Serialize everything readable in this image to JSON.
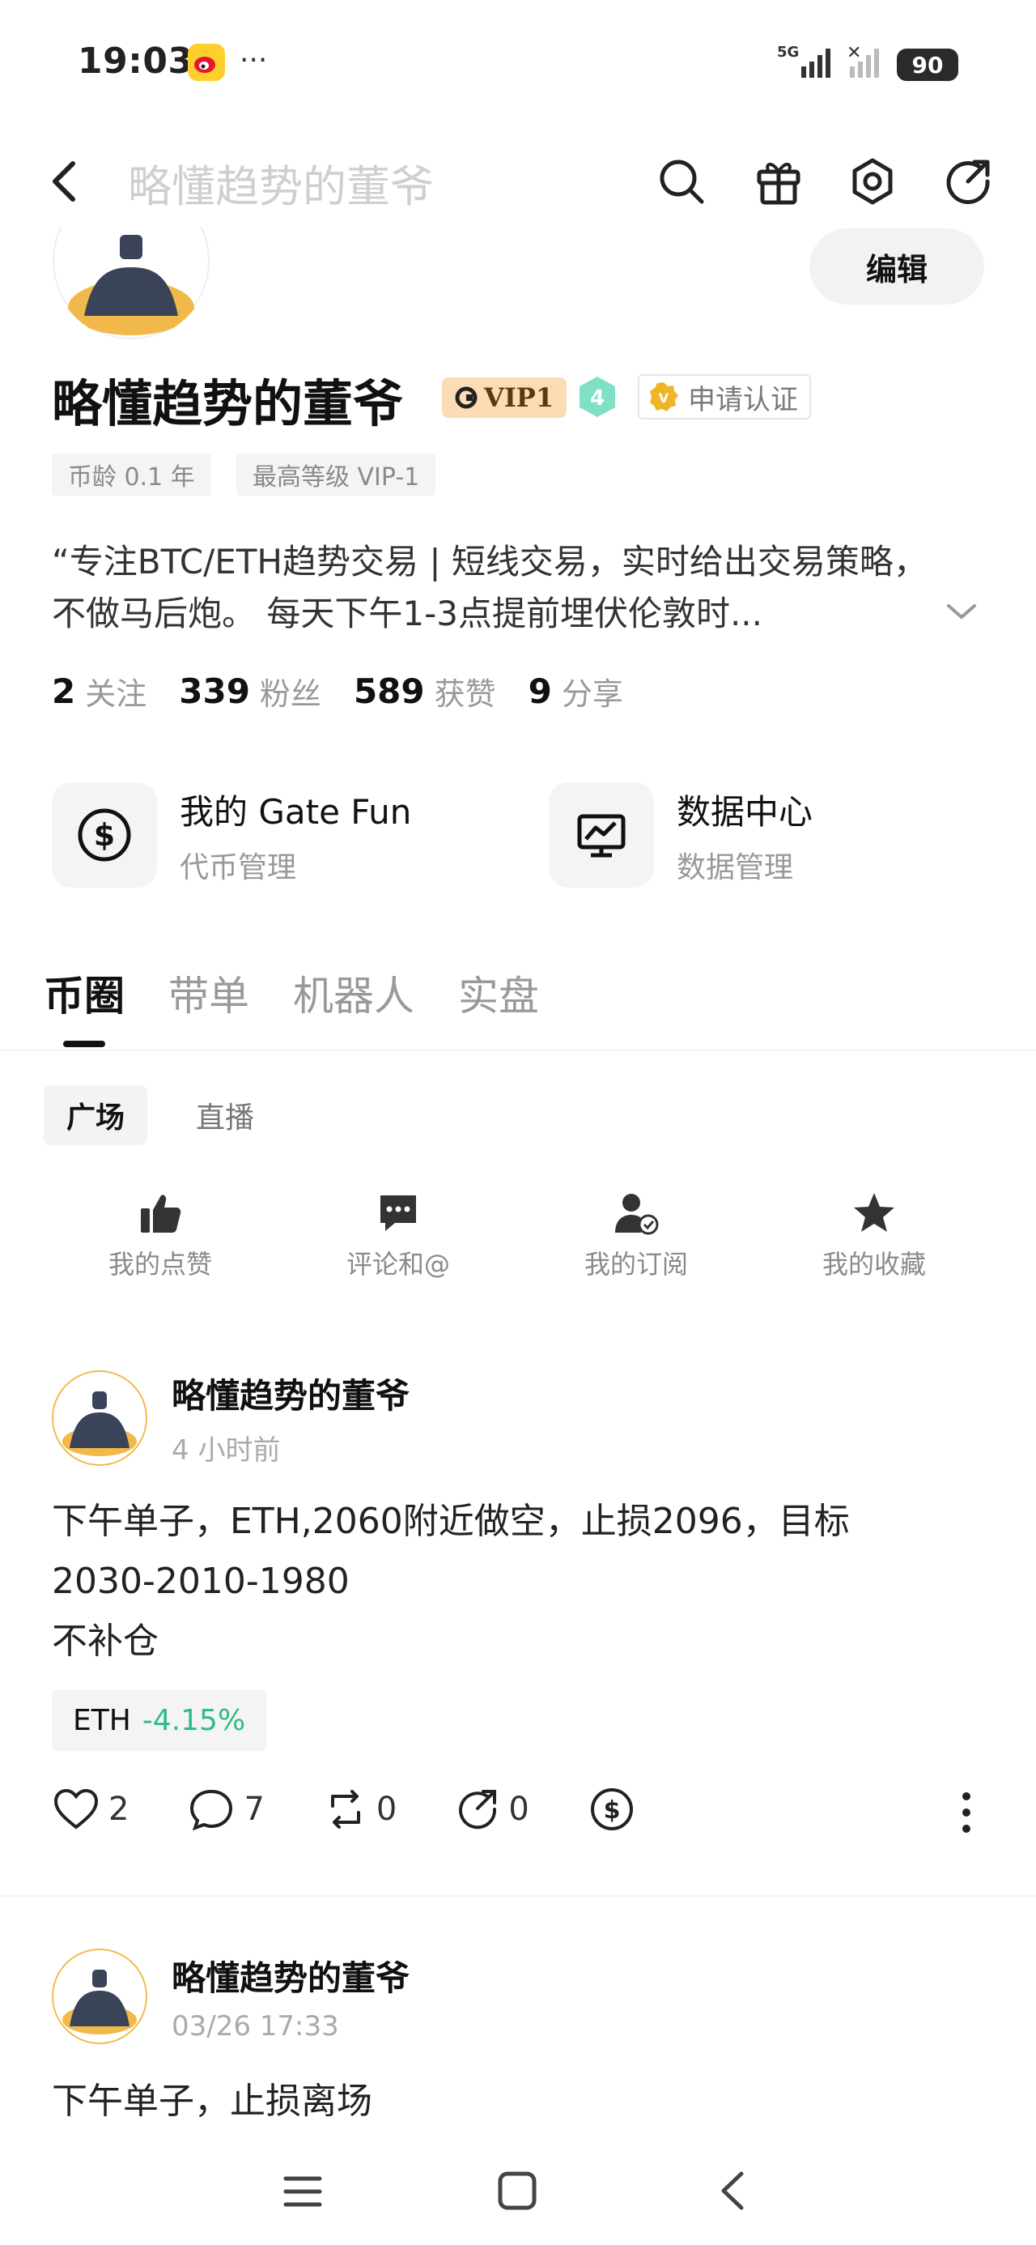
{
  "status_bar": {
    "time": "19:03",
    "dots": "···",
    "network": "5G",
    "battery": "90"
  },
  "nav": {
    "title": "略懂趋势的董爷"
  },
  "profile": {
    "edit_label": "编辑",
    "name": "略懂趋势的董爷",
    "vip_label": "VIP1",
    "level": "4",
    "verify_label": "申请认证",
    "tags": [
      "币龄 0.1 年",
      "最高等级 VIP-1"
    ],
    "bio_line1": "“专注BTC/ETH趋势交易 | 短线交易，实时给出交易策略，",
    "bio_line2": "不做马后炮。 每天下午1-3点提前埋伏伦敦时...",
    "stats": [
      {
        "value": "2",
        "label": "关注"
      },
      {
        "value": "339",
        "label": "粉丝"
      },
      {
        "value": "589",
        "label": "获赞"
      },
      {
        "value": "9",
        "label": "分享"
      }
    ]
  },
  "cards": [
    {
      "title": "我的 Gate Fun",
      "subtitle": "代币管理",
      "icon": "dollar-circle-icon"
    },
    {
      "title": "数据中心",
      "subtitle": "数据管理",
      "icon": "chart-monitor-icon"
    }
  ],
  "tabs": [
    "币圈",
    "带单",
    "机器人",
    "实盘"
  ],
  "subtabs": [
    "广场",
    "直播"
  ],
  "quick_actions": [
    {
      "label": "我的点赞",
      "icon": "thumbs-up-icon"
    },
    {
      "label": "评论和@",
      "icon": "comment-icon"
    },
    {
      "label": "我的订阅",
      "icon": "user-check-icon"
    },
    {
      "label": "我的收藏",
      "icon": "star-icon"
    }
  ],
  "posts": [
    {
      "author": "略懂趋势的董爷",
      "time": "4 小时前",
      "line1": "下午单子，ETH,2060附近做空，止损2096，目标",
      "line2": "2030-2010-1980",
      "line3": "不补仓",
      "coin": "ETH",
      "change": "-4.15%",
      "likes": "2",
      "comments": "7",
      "reposts": "0",
      "shares": "0"
    },
    {
      "author": "略懂趋势的董爷",
      "time": "03/26 17:33",
      "line1": "下午单子，止损离场"
    }
  ],
  "colors": {
    "accent_green": "#2ebd85",
    "vip_bg": "#fbdcb5",
    "gold": "#f0b429"
  }
}
